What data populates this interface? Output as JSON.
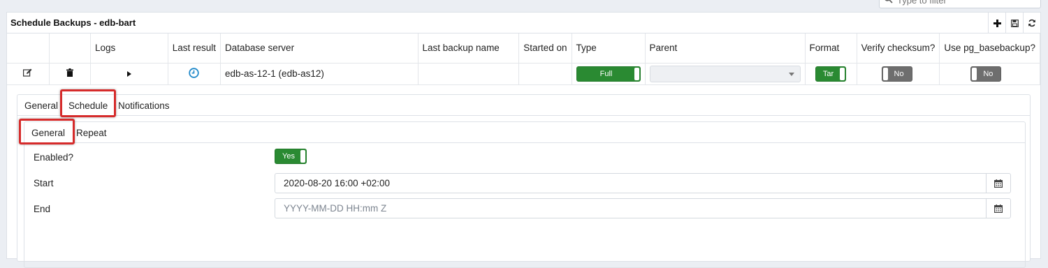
{
  "filter": {
    "placeholder": "Type to filter"
  },
  "panel": {
    "title": "Schedule Backups - edb-bart",
    "header_buttons": [
      "add-icon",
      "save-icon",
      "refresh-icon"
    ]
  },
  "grid": {
    "columns": [
      "",
      "",
      "Logs",
      "Last result",
      "Database server",
      "Last backup name",
      "Started on",
      "Type",
      "Parent",
      "Format",
      "Verify checksum?",
      "Use pg_basebackup?"
    ],
    "row": {
      "database_server": "edb-as-12-1 (edb-as12)",
      "last_backup_name": "",
      "started_on": "",
      "type": "Full",
      "parent": "",
      "format": "Tar",
      "verify_checksum": "No",
      "use_pg_basebackup": "No"
    }
  },
  "tabs": [
    "General",
    "Schedule",
    "Notifications"
  ],
  "subtabs": [
    "General",
    "Repeat"
  ],
  "form": {
    "enabled_label": "Enabled?",
    "enabled_value": "Yes",
    "start_label": "Start",
    "start_value": "2020-08-20 16:00 +02:00",
    "end_label": "End",
    "end_placeholder": "YYYY-MM-DD HH:mm Z"
  },
  "colors": {
    "toggle_on": "#2a8a32",
    "toggle_off": "#6e6e6e",
    "highlight": "#d62b2b",
    "clock": "#1e88c9"
  }
}
